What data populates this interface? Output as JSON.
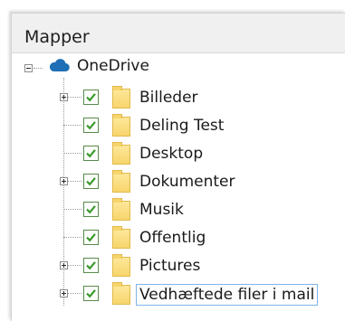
{
  "panel": {
    "header_label": "Mapper"
  },
  "root": {
    "label": "OneDrive",
    "icon": "cloud-icon",
    "expanded": true
  },
  "folders": [
    {
      "label": "Billeder",
      "expandable": true,
      "checked": true
    },
    {
      "label": "Deling Test",
      "expandable": false,
      "checked": true
    },
    {
      "label": "Desktop",
      "expandable": false,
      "checked": true
    },
    {
      "label": "Dokumenter",
      "expandable": true,
      "checked": true
    },
    {
      "label": "Musik",
      "expandable": false,
      "checked": true
    },
    {
      "label": "Offentlig",
      "expandable": false,
      "checked": true
    },
    {
      "label": "Pictures",
      "expandable": true,
      "checked": true
    },
    {
      "label": "Vedhæftede filer i mail",
      "expandable": true,
      "checked": true,
      "selected": true
    }
  ],
  "colors": {
    "checkmark": "#3c9a2e",
    "cloud": "#1e6fb5",
    "folder": "#f7d56c",
    "selection_border": "#7eb4ea"
  }
}
